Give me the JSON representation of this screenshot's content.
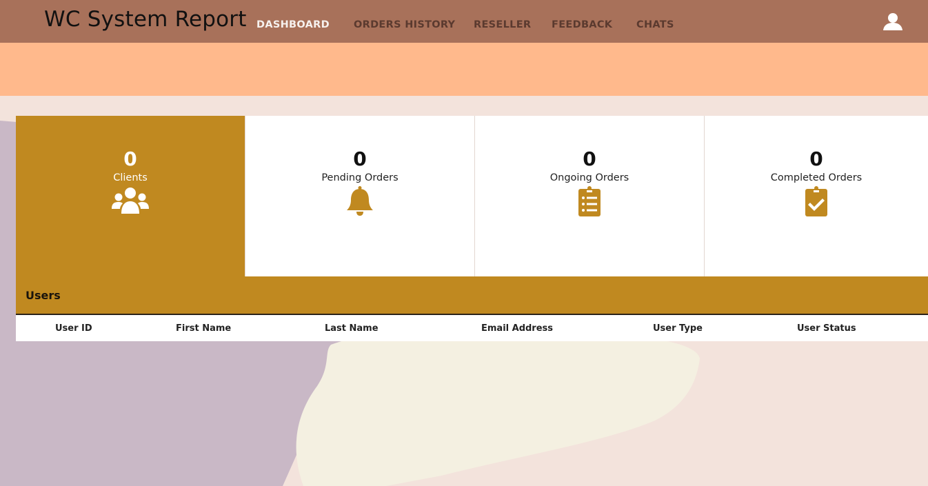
{
  "app": {
    "title": "WC System Report"
  },
  "nav": {
    "items": [
      {
        "label": "DASHBOARD",
        "active": true
      },
      {
        "label": "ORDERS HISTORY",
        "active": false
      },
      {
        "label": "RESELLER",
        "active": false
      },
      {
        "label": "FEEDBACK",
        "active": false
      },
      {
        "label": "CHATS",
        "active": false
      }
    ],
    "user_icon": "user-icon"
  },
  "stats": [
    {
      "count": "0",
      "label": "Clients",
      "icon": "users-group-icon"
    },
    {
      "count": "0",
      "label": "Pending Orders",
      "icon": "bell-icon"
    },
    {
      "count": "0",
      "label": "Ongoing Orders",
      "icon": "clipboard-list-icon"
    },
    {
      "count": "0",
      "label": "Completed Orders",
      "icon": "clipboard-check-icon"
    }
  ],
  "users": {
    "title": "Users",
    "columns": [
      "User ID",
      "First Name",
      "Last Name",
      "Email Address",
      "User Type",
      "User Status"
    ],
    "rows": []
  },
  "colors": {
    "nav_bg": "#a8715a",
    "banner": "#ffb98c",
    "accent": "#c08920",
    "page_bg": "#f3e3dc"
  }
}
